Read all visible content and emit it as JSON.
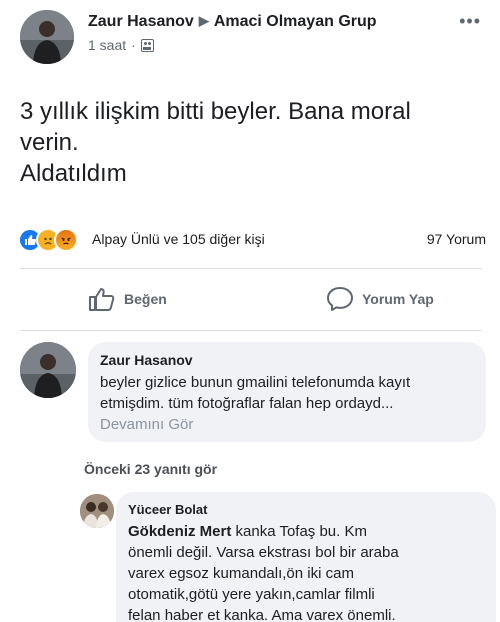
{
  "post": {
    "author": "Zaur Hasanov",
    "group": "Amaci Olmayan Grup",
    "time": "1 saat",
    "dot": "·",
    "more_icon": "more-horizontal-icon",
    "body_lines": [
      "3 yıllık ilişkim bitti beyler. Bana moral",
      "verin.",
      "Aldatıldım"
    ]
  },
  "reactions": {
    "icons": [
      "like-icon",
      "sad-icon",
      "angry-icon"
    ],
    "names": "Alpay Ünlü ve 105 diğer kişi",
    "comments": "97 Yorum"
  },
  "actions": {
    "like_label": "Beğen",
    "comment_label": "Yorum Yap"
  },
  "comment1": {
    "author": "Zaur Hasanov",
    "text": "beyler gizlice bunun gmailini telefonumda kayıt\netmişdim. tüm fotoğraflar falan hep ordayd...",
    "more": "Devamını Gör"
  },
  "previous_replies": "Önceki 23 yanıtı gör",
  "comment2": {
    "author": "Yüceer Bolat",
    "tag": "Gökdeniz Mert",
    "text": " kanka Tofaş bu. Km\nönemli değil. Varsa ekstrası bol bir araba\nvarex egsoz kumandalı,ön iki cam\notomatik,götü yere yakın,camlar filmli\nfelan haber et kanka. Ama varex önemli."
  },
  "colors": {
    "like_blue": "#1877f2",
    "text_secondary": "#606770",
    "bubble_bg": "#f0f2f5"
  }
}
